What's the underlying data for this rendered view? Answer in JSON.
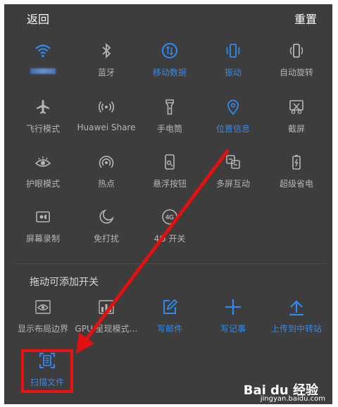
{
  "topbar": {
    "back_label": "返回",
    "reset_label": "重置"
  },
  "tiles": [
    {
      "label": "",
      "icon": "wifi-icon",
      "active": true
    },
    {
      "label": "蓝牙",
      "icon": "bluetooth-icon",
      "active": false
    },
    {
      "label": "移动数据",
      "icon": "mobile-data-icon",
      "active": true
    },
    {
      "label": "振动",
      "icon": "vibrate-icon",
      "active": true
    },
    {
      "label": "自动旋转",
      "icon": "rotate-icon",
      "active": false
    },
    {
      "label": "飞行模式",
      "icon": "airplane-icon",
      "active": false
    },
    {
      "label": "Huawei Share",
      "icon": "huawei-share-icon",
      "active": false
    },
    {
      "label": "手电筒",
      "icon": "flashlight-icon",
      "active": false
    },
    {
      "label": "位置信息",
      "icon": "location-icon",
      "active": true
    },
    {
      "label": "截屏",
      "icon": "screenshot-icon",
      "active": false
    },
    {
      "label": "护眼模式",
      "icon": "eye-icon",
      "active": false
    },
    {
      "label": "热点",
      "icon": "hotspot-icon",
      "active": false
    },
    {
      "label": "悬浮按钮",
      "icon": "floating-button-icon",
      "active": false
    },
    {
      "label": "多屏互动",
      "icon": "multiscreen-icon",
      "active": false
    },
    {
      "label": "超级省电",
      "icon": "battery-icon",
      "active": false
    },
    {
      "label": "屏幕录制",
      "icon": "screen-record-icon",
      "active": false
    },
    {
      "label": "免打扰",
      "icon": "moon-icon",
      "active": false
    },
    {
      "label": "4G 开关",
      "icon": "4g-icon",
      "active": false
    }
  ],
  "section_label": "拖动可添加开关",
  "add_tiles": [
    {
      "label": "显示布局边界",
      "icon": "layout-bounds-icon",
      "active": false
    },
    {
      "label": "GPU 呈现模式…",
      "icon": "gpu-icon",
      "active": false
    },
    {
      "label": "写邮件",
      "icon": "edit-icon",
      "active": true
    },
    {
      "label": "写记事",
      "icon": "plus-icon",
      "active": true
    },
    {
      "label": "上传到中转站",
      "icon": "upload-icon",
      "active": true
    },
    {
      "label": "扫描文件",
      "icon": "scan-document-icon",
      "active": true
    }
  ],
  "watermark": {
    "brand": "Bai du 经验",
    "url": "jingyan.baidu.com"
  },
  "colors": {
    "accent": "#2f8bf0",
    "inactive": "#b5b5b5",
    "background": "#3d3d3d",
    "annotation": "#e11111"
  }
}
